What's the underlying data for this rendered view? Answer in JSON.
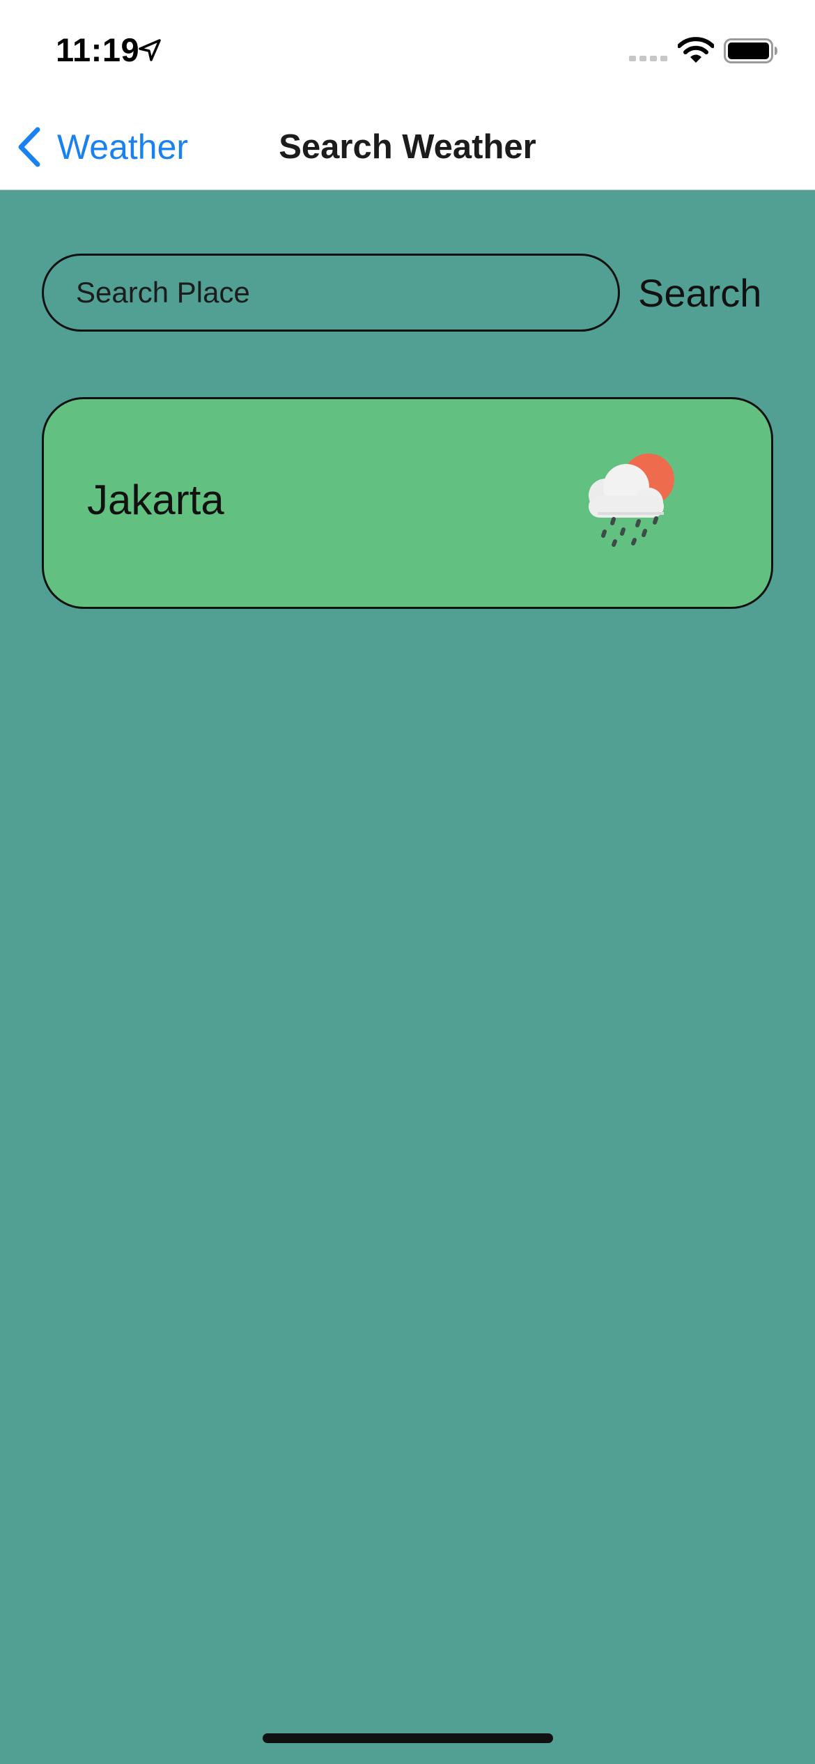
{
  "status_bar": {
    "time": "11:19",
    "icons": [
      "location-arrow-icon",
      "cellular-signal-icon",
      "wifi-icon",
      "battery-icon"
    ]
  },
  "nav": {
    "back_label": "Weather",
    "title": "Search Weather",
    "accent_color": "#1a82f0"
  },
  "search": {
    "placeholder": "Search Place",
    "value": "",
    "button_label": "Search"
  },
  "results": [
    {
      "city": "Jakarta",
      "weather_icon": "cloud-sun-rain-icon"
    }
  ],
  "colors": {
    "background": "#529f93",
    "card": "#62c081",
    "sun": "#ee6c4d"
  }
}
